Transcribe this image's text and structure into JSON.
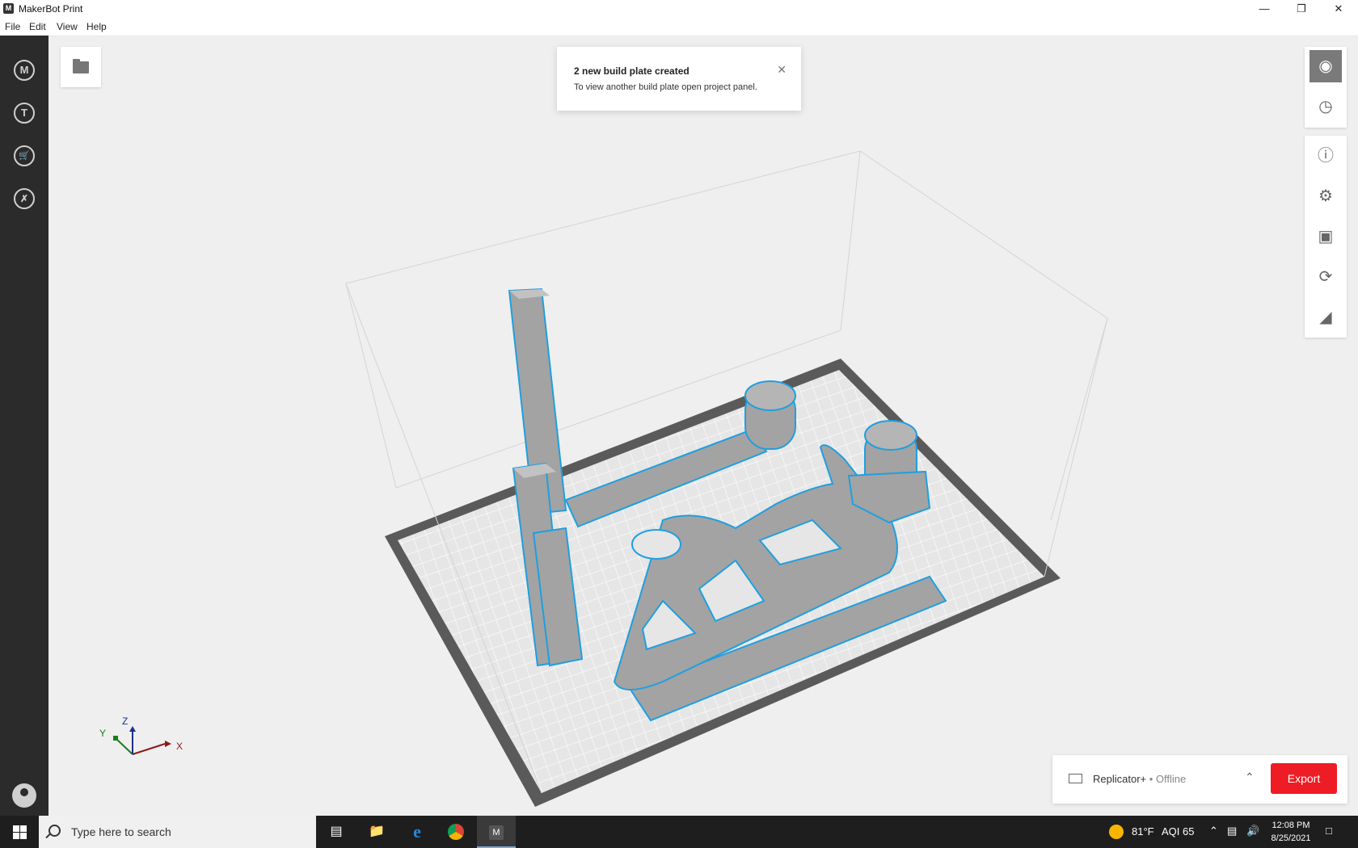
{
  "window": {
    "title": "MakerBot Print",
    "app_icon": "makerbot-m-icon",
    "controls": [
      "minimize-icon",
      "restore-icon",
      "close-icon"
    ]
  },
  "menu": {
    "items": [
      "File",
      "Edit",
      "View",
      "Help"
    ]
  },
  "left_sidebar": {
    "icons": [
      "makerbot-logo-icon",
      "thingiverse-icon",
      "store-cart-icon",
      "tools-icon",
      "account-avatar-icon"
    ]
  },
  "toast": {
    "title": "2 new build plate created",
    "message": "To view another build plate open project panel.",
    "close_icon": "close-icon"
  },
  "axis": {
    "x": "X",
    "y": "Y",
    "z": "Z"
  },
  "right_panel": {
    "view_icons": [
      "view-3d-icon",
      "print-preview-icon"
    ],
    "tool_icons": [
      "info-icon",
      "settings-gear-icon",
      "arrange-icon",
      "rotate-icon",
      "scale-icon"
    ]
  },
  "printer": {
    "name": "Replicator+",
    "status": " • Offline",
    "export_label": "Export"
  },
  "taskbar": {
    "search_placeholder": "Type here to search",
    "weather_temp": "81°F",
    "aqi": "AQI 65",
    "time": "12:08 PM",
    "date": "8/25/2021"
  },
  "colors": {
    "accent_red": "#ee1c24",
    "sidebar_dark": "#2b2b2b",
    "selection_blue": "#1e9fe0",
    "model_gray": "#9a9a9a"
  }
}
